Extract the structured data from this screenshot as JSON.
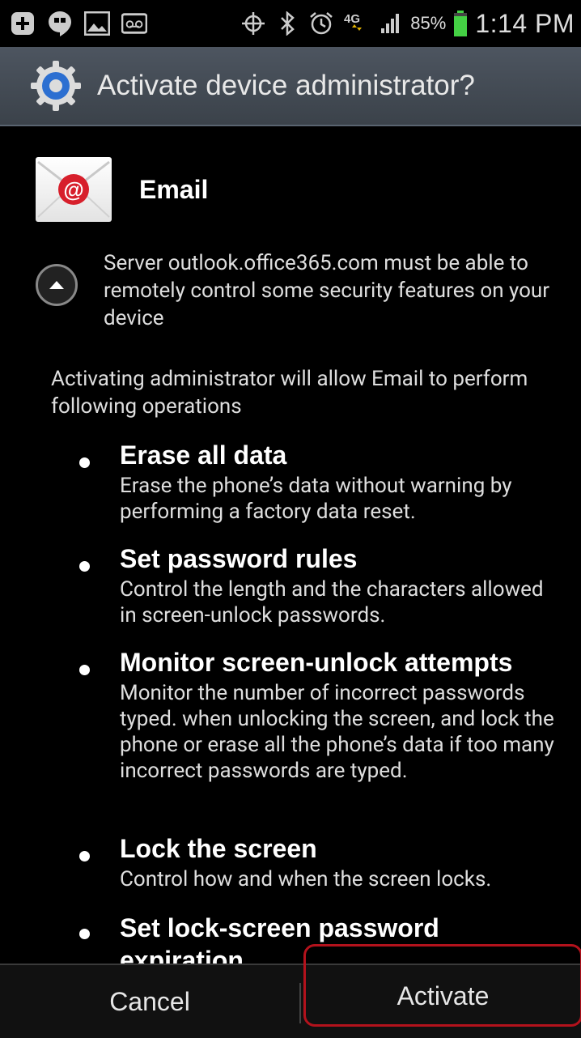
{
  "status_bar": {
    "battery_percent": "85%",
    "time": "1:14 PM",
    "network": "4G",
    "icons": [
      "plus-icon",
      "hangouts-icon",
      "gallery-icon",
      "voicemail-icon",
      "gps-icon",
      "bluetooth-icon",
      "alarm-icon",
      "4g-icon",
      "signal-icon",
      "battery-icon"
    ],
    "battery_color": "#44d044"
  },
  "dialog": {
    "title": "Activate device administrator?",
    "app_name": "Email",
    "server_message": "Server outlook.office365.com must be able to remotely control some security features on your device",
    "intro": "Activating administrator will allow Email to perform following operations",
    "permissions": [
      {
        "title": "Erase all data",
        "desc": "Erase the phone’s data without warning by performing a factory data reset."
      },
      {
        "title": "Set password rules",
        "desc": "Control the length and the characters allowed in screen-unlock passwords."
      },
      {
        "title": "Monitor screen-unlock attempts",
        "desc": "Monitor the number of incorrect passwords typed. when unlocking the screen, and lock the phone or erase all the phone’s data if too many incorrect passwords are typed."
      },
      {
        "title": "Lock the screen",
        "desc": "Control how and when the screen locks."
      },
      {
        "title": "Set lock-screen password expiration",
        "desc": ""
      }
    ]
  },
  "buttons": {
    "cancel": "Cancel",
    "activate": "Activate"
  },
  "colors": {
    "highlight": "#b3121c",
    "title_bar": "#444b54"
  }
}
